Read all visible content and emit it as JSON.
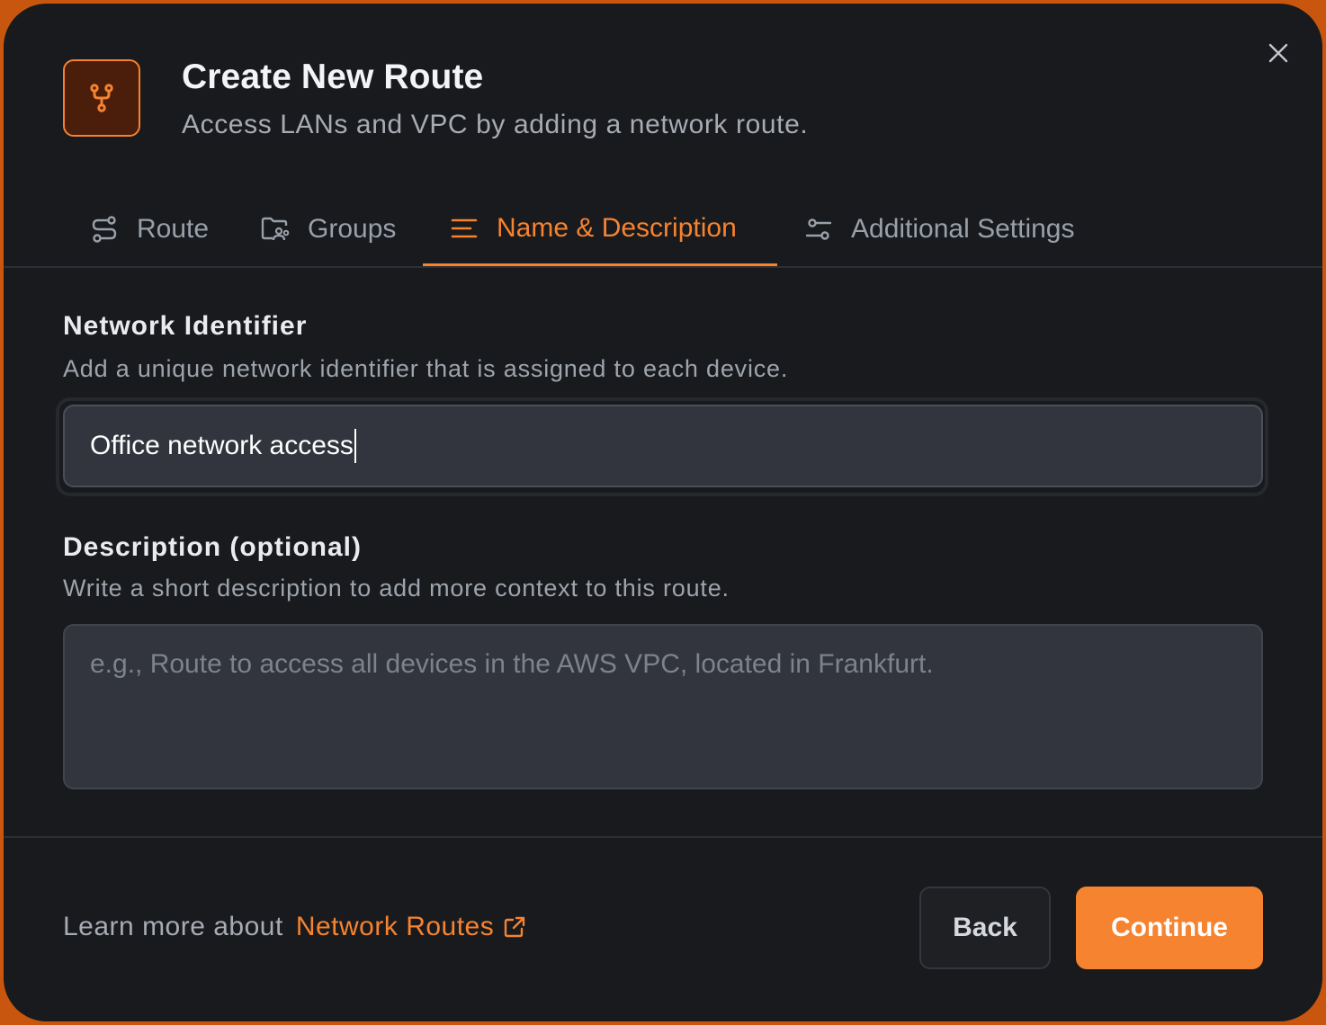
{
  "dialog": {
    "title": "Create New Route",
    "subtitle": "Access LANs and VPC by adding a network route.",
    "header_icon": "route-fork-icon",
    "close_icon": "close-icon"
  },
  "tabs": [
    {
      "label": "Route",
      "icon": "route-icon",
      "active": false
    },
    {
      "label": "Groups",
      "icon": "folder-group-icon",
      "active": false
    },
    {
      "label": "Name & Description",
      "icon": "text-lines-icon",
      "active": true
    },
    {
      "label": "Additional Settings",
      "icon": "sliders-icon",
      "active": false
    }
  ],
  "network_identifier": {
    "label": "Network Identifier",
    "help": "Add a unique network identifier that is assigned to each device.",
    "value": "Office network access"
  },
  "description": {
    "label": "Description (optional)",
    "help": "Write a short description to add more context to this route.",
    "placeholder": "e.g., Route to access all devices in the AWS VPC, located in Frankfurt.",
    "value": ""
  },
  "footer": {
    "learn_prefix": "Learn more about",
    "learn_link": "Network Routes",
    "back_label": "Back",
    "continue_label": "Continue"
  },
  "colors": {
    "accent": "#f68330",
    "background": "#181a1d",
    "input_bg": "#32353e"
  }
}
